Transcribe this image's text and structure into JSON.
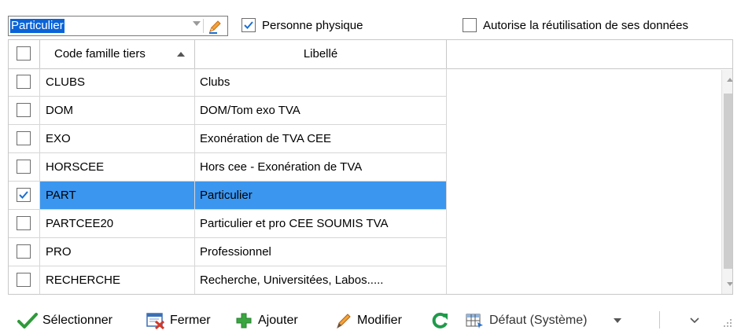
{
  "filter": {
    "combo_value": "Particulier",
    "personne_physique_label": "Personne physique",
    "personne_physique_checked": true,
    "autorise_label": "Autorise la réutilisation de ses données",
    "autorise_checked": false
  },
  "grid": {
    "headers": [
      "Code famille tiers",
      "Libellé"
    ],
    "rows": [
      {
        "code": "CLUBS",
        "libelle": "Clubs",
        "checked": false,
        "selected": false
      },
      {
        "code": "DOM",
        "libelle": "DOM/Tom exo TVA",
        "checked": false,
        "selected": false
      },
      {
        "code": "EXO",
        "libelle": "Exonération de TVA CEE",
        "checked": false,
        "selected": false
      },
      {
        "code": "HORSCEE",
        "libelle": "Hors cee - Exonération de TVA",
        "checked": false,
        "selected": false
      },
      {
        "code": "PART",
        "libelle": "Particulier",
        "checked": true,
        "selected": true
      },
      {
        "code": "PARTCEE20",
        "libelle": "Particulier et pro CEE SOUMIS TVA",
        "checked": false,
        "selected": false
      },
      {
        "code": "PRO",
        "libelle": "Professionnel",
        "checked": false,
        "selected": false
      },
      {
        "code": "RECHERCHE",
        "libelle": "Recherche, Universitées, Labos.....",
        "checked": false,
        "selected": false
      }
    ]
  },
  "toolbar": {
    "select_label": "Sélectionner",
    "close_label": "Fermer",
    "add_label": "Ajouter",
    "edit_label": "Modifier",
    "view_label": "Défaut (Système)"
  },
  "colors": {
    "selection": "#3b96f0",
    "check_blue": "#1a6fd1",
    "select_green": "#2e9a3a",
    "close_red": "#d23a2a",
    "add_green": "#3aa640",
    "edit_orange": "#e07a1a",
    "refresh_green": "#1f9a4a"
  },
  "icons": [
    "checkmark-icon",
    "close-window-icon",
    "plus-icon",
    "pencil-icon",
    "refresh-icon",
    "table-view-icon",
    "chevron-down-icon",
    "resize-grip-icon"
  ]
}
